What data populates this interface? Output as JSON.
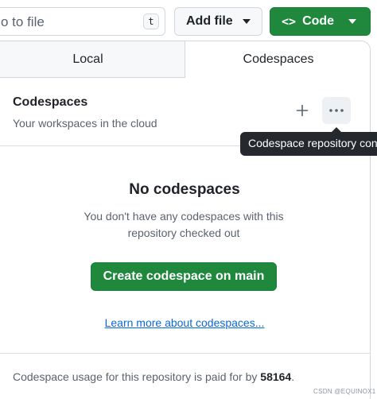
{
  "toolbar": {
    "goto_text": "o to file",
    "goto_shortcut": "t",
    "add_file_label": "Add file",
    "code_icon": "<>",
    "code_label": "Code"
  },
  "panel": {
    "tabs": [
      {
        "label": "Local",
        "active": false
      },
      {
        "label": "Codespaces",
        "active": true
      }
    ],
    "section": {
      "title": "Codespaces",
      "subtitle": "Your workspaces in the cloud"
    },
    "empty": {
      "title": "No codespaces",
      "description": "You don't have any codespaces with this repository checked out",
      "create_button": "Create codespace on main",
      "learn_link": "Learn more about codespaces..."
    },
    "footer": {
      "prefix": "Codespace usage for this repository is paid for by ",
      "payer": "58164",
      "suffix": "."
    }
  },
  "tooltip": {
    "text": "Codespace repository con"
  },
  "watermark": "CSDN @EQUINOX1",
  "icons": {
    "plus": "plus-icon",
    "more": "kebab-horizontal-icon",
    "caret": "triangle-down-icon",
    "code": "code-icon"
  },
  "colors": {
    "primary_green": "#1f883d",
    "link_blue": "#0969da",
    "tooltip_bg": "#25292e",
    "muted_text": "#59636e",
    "border": "#d0d7de"
  }
}
